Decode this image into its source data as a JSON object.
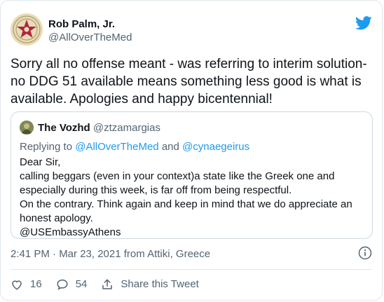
{
  "tweet": {
    "author_name": "Rob Palm, Jr.",
    "author_handle": "@AllOverTheMed",
    "text": "Sorry all no offense meant - was referring to interim solution-\nno DDG 51 available means something less good is what is\navailable. Apologies and happy bicentennial!",
    "meta": "2:41 PM · Mar 23, 2021 from Attiki, Greece"
  },
  "quoted": {
    "author_name": "The Vozhd",
    "author_handle": "@ztzamargias",
    "replying_prefix": "Replying to ",
    "replying_user1": "@AllOverTheMed",
    "replying_and": " and ",
    "replying_user2": "@cynaegeirus",
    "body": "Dear Sir,\ncalling beggars (even in your context)a state like the Greek one and\nespecially during this week, is far off from being respectful.\nOn the contrary. Think again and keep in mind that we do appreciate an\nhonest apology.\n@USEmbassyAthens"
  },
  "actions": {
    "likes": "16",
    "replies": "54",
    "share_label": "Share this Tweet"
  },
  "icons": {
    "brand": "twitter-bird-icon",
    "info": "info-icon",
    "like": "heart-icon",
    "reply": "speech-bubble-icon",
    "share": "share-icon"
  },
  "colors": {
    "accent": "#1d9bf0",
    "text": "#0f1419",
    "muted": "#536471",
    "border": "#cfd9de"
  }
}
